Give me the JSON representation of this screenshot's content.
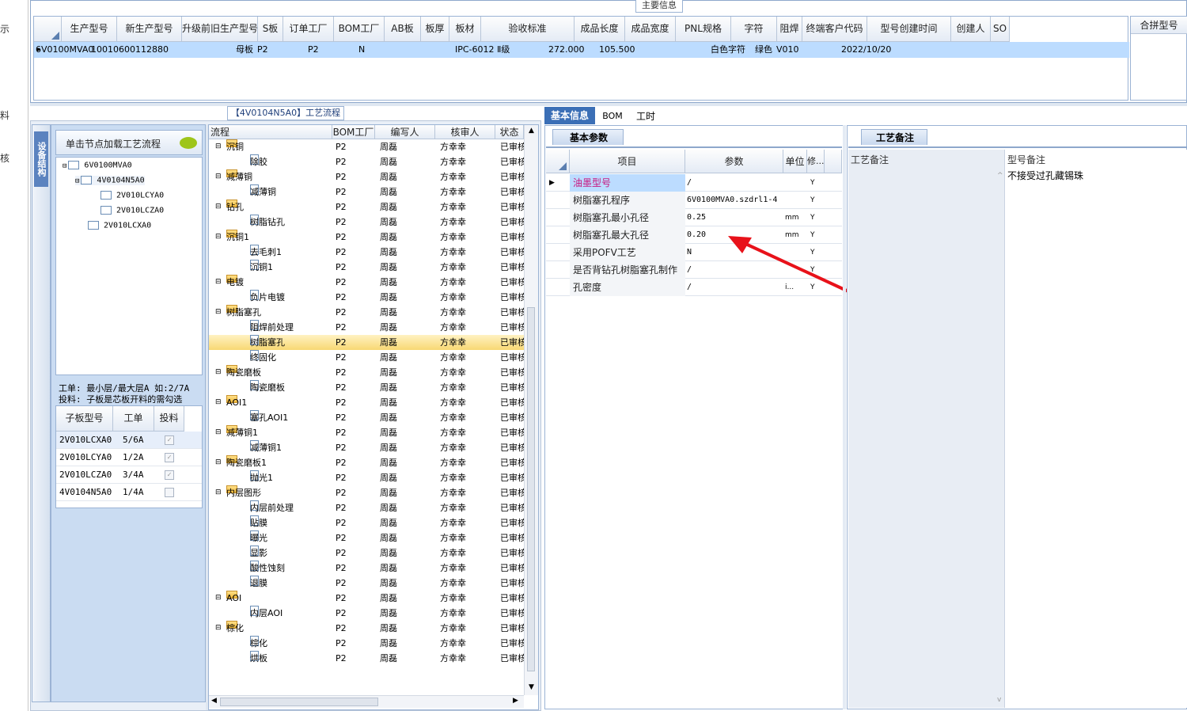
{
  "left_edge_chars": [
    "示",
    "料",
    "核"
  ],
  "main_info": {
    "title": "主要信息",
    "columns": [
      "生产型号",
      "新生产型号",
      "升级前旧生产型号",
      "S板",
      "订单工厂",
      "BOM工厂",
      "AB板",
      "板厚",
      "板材",
      "验收标准",
      "成品长度",
      "成品宽度",
      "PNL规格",
      "字符",
      "阻焊",
      "终端客户代码",
      "型号创建时间",
      "创建人",
      "SO"
    ],
    "row": [
      "6V0100MVA0",
      "10010600112880",
      "",
      "母板",
      "P2",
      "P2",
      "N",
      "",
      "",
      "IPC-6012 Ⅱ级",
      "272.000",
      "105.500",
      "",
      "白色字符",
      "绿色",
      "V010",
      "2022/10/20",
      "",
      ""
    ],
    "side_header": "合拼型号"
  },
  "flow_title": "【4V0104N5A0】工艺流程",
  "left_panel": {
    "tab_label": "设备结构",
    "load_button": "单击节点加载工艺流程",
    "tree": [
      "6V0100MVA0",
      "4V0104N5A0",
      "2V010LCYA0",
      "2V010LCZA0",
      "2V010LCXA0"
    ],
    "note_line1": "工单: 最小层/最大层A 如:2/7A",
    "note_line2": "投料: 子板是芯板开料的需勾选",
    "sub_headers": [
      "子板型号",
      "工单",
      "投料"
    ],
    "sub_rows": [
      {
        "model": "2V010LCXA0",
        "order": "5/6A",
        "checked": true
      },
      {
        "model": "2V010LCYA0",
        "order": "1/2A",
        "checked": true
      },
      {
        "model": "2V010LCZA0",
        "order": "3/4A",
        "checked": true
      },
      {
        "model": "4V0104N5A0",
        "order": "1/4A",
        "checked": false
      }
    ]
  },
  "flow": {
    "headers": [
      "流程",
      "BOM工厂",
      "编写人",
      "核审人",
      "状态"
    ],
    "rows": [
      {
        "name": "沉铜",
        "type": "folder"
      },
      {
        "name": "除胶",
        "type": "file"
      },
      {
        "name": "减薄铜",
        "type": "folder"
      },
      {
        "name": "减薄铜",
        "type": "file"
      },
      {
        "name": "钻孔",
        "type": "folder"
      },
      {
        "name": "树脂钻孔",
        "type": "file"
      },
      {
        "name": "沉铜1",
        "type": "folder"
      },
      {
        "name": "去毛刺1",
        "type": "file"
      },
      {
        "name": "沉铜1",
        "type": "file"
      },
      {
        "name": "电镀",
        "type": "folder"
      },
      {
        "name": "负片电镀",
        "type": "file"
      },
      {
        "name": "树脂塞孔",
        "type": "folder"
      },
      {
        "name": "阻焊前处理",
        "type": "file"
      },
      {
        "name": "树脂塞孔",
        "type": "file",
        "selected": true
      },
      {
        "name": "终固化",
        "type": "file"
      },
      {
        "name": "陶瓷磨板",
        "type": "folder"
      },
      {
        "name": "陶瓷磨板",
        "type": "file"
      },
      {
        "name": "AOI1",
        "type": "folder"
      },
      {
        "name": "塞孔AOI1",
        "type": "file"
      },
      {
        "name": "减薄铜1",
        "type": "folder"
      },
      {
        "name": "减薄铜1",
        "type": "file"
      },
      {
        "name": "陶瓷磨板1",
        "type": "folder"
      },
      {
        "name": "抛光1",
        "type": "file"
      },
      {
        "name": "内层图形",
        "type": "folder"
      },
      {
        "name": "内层前处理",
        "type": "file"
      },
      {
        "name": "贴膜",
        "type": "file"
      },
      {
        "name": "曝光",
        "type": "file"
      },
      {
        "name": "显影",
        "type": "file"
      },
      {
        "name": "酸性蚀刻",
        "type": "file"
      },
      {
        "name": "退膜",
        "type": "file"
      },
      {
        "name": "AOI",
        "type": "folder"
      },
      {
        "name": "内层AOI",
        "type": "file"
      },
      {
        "name": "棕化",
        "type": "folder"
      },
      {
        "name": "棕化",
        "type": "file"
      },
      {
        "name": "烘板",
        "type": "file"
      }
    ],
    "bom": "P2",
    "writer": "周磊",
    "reviewer": "方幸幸",
    "status": "已审核"
  },
  "right_tabs": [
    "基本信息",
    "BOM",
    "工时"
  ],
  "params": {
    "tab": "基本参数",
    "headers": [
      "项目",
      "参数",
      "单位",
      "修..."
    ],
    "rows": [
      {
        "item": "油墨型号",
        "value": "/",
        "unit": "",
        "flag": "Y",
        "highlight": true
      },
      {
        "item": "树脂塞孔程序",
        "value": "6V0100MVA0.szdrl1-4",
        "unit": "",
        "flag": "Y"
      },
      {
        "item": "树脂塞孔最小孔径",
        "value": "0.25",
        "unit": "mm",
        "flag": "Y"
      },
      {
        "item": "树脂塞孔最大孔径",
        "value": "0.20",
        "unit": "mm",
        "flag": "Y"
      },
      {
        "item": "采用POFV工艺",
        "value": "N",
        "unit": "",
        "flag": "Y"
      },
      {
        "item": "是否背钻孔树脂塞孔制作",
        "value": "/",
        "unit": "",
        "flag": "Y"
      },
      {
        "item": "孔密度",
        "value": "/",
        "unit": "i...",
        "flag": "Y"
      }
    ]
  },
  "remarks": {
    "tab": "工艺备注",
    "col1": "工艺备注",
    "col2": "型号备注",
    "value": "不接受过孔藏锡珠"
  },
  "accent": "#3b6fb6",
  "arrow_color": "#e8121a"
}
